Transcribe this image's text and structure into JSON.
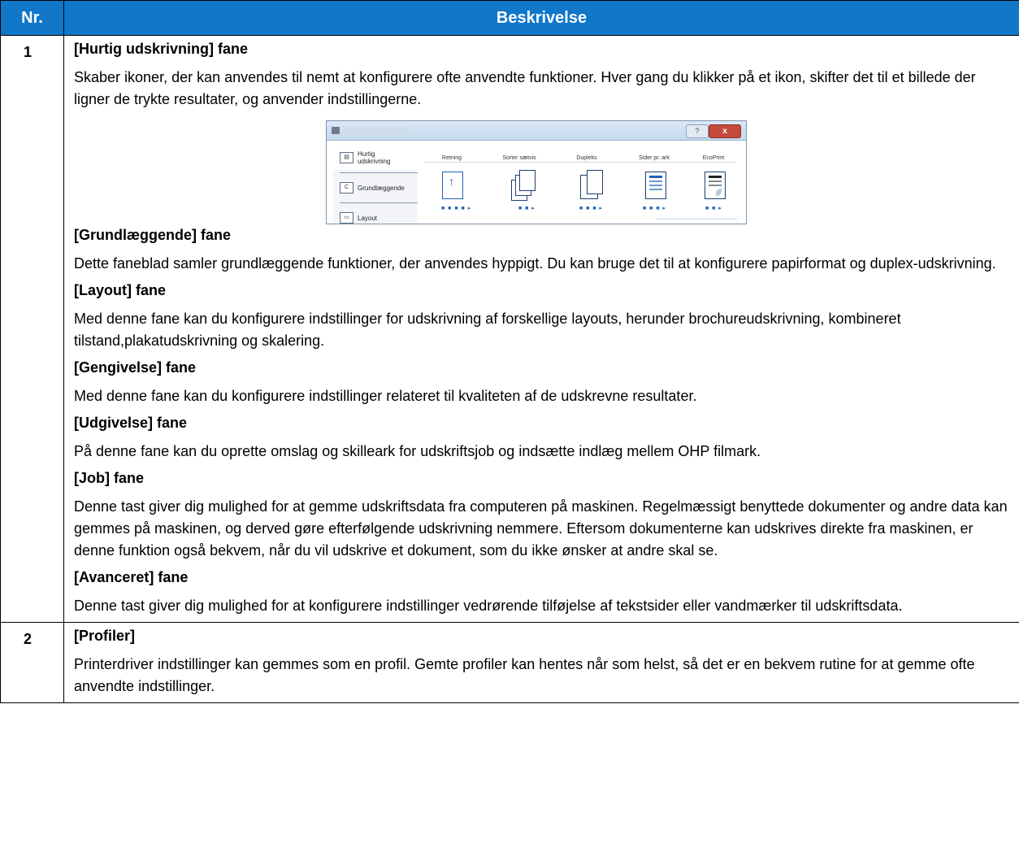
{
  "header": {
    "col_nr": "Nr.",
    "col_desc": "Beskrivelse"
  },
  "colors": {
    "header_bg": "#1177c9",
    "header_text": "#ffffff",
    "dialog_accent": "#1f62b5"
  },
  "rows": [
    {
      "num": "1",
      "sections": [
        {
          "title": "[Hurtig udskrivning] fane",
          "body": "Skaber ikoner, der kan anvendes til nemt at konfigurere ofte anvendte funktioner. Hver gang du klikker på et ikon, skifter det til et billede der ligner de trykte resultater, og anvender indstillingerne."
        },
        {
          "title": "[Grundlæggende] fane",
          "body": "Dette faneblad samler grundlæggende funktioner, der anvendes hyppigt. Du kan bruge det til at konfigurere papirformat og duplex-udskrivning."
        },
        {
          "title": "[Layout] fane",
          "body": "Med denne fane kan du konfigurere indstillinger for udskrivning af forskellige layouts, herunder brochureudskrivning, kombineret tilstand,plakatudskrivning og skalering."
        },
        {
          "title": "[Gengivelse] fane",
          "body": "Med denne fane kan du konfigurere indstillinger relateret til kvaliteten af de udskrevne resultater."
        },
        {
          "title": "[Udgivelse] fane",
          "body": "På denne fane kan du oprette omslag og skilleark for udskriftsjob og indsætte indlæg mellem OHP filmark."
        },
        {
          "title": "[Job] fane",
          "body": "Denne tast giver dig mulighed for at gemme udskriftsdata fra computeren på maskinen. Regelmæssigt benyttede dokumenter og andre data kan gemmes på maskinen, og derved gøre efterfølgende udskrivning nemmere. Eftersom dokumenterne kan udskrives direkte fra maskinen, er denne funktion også bekvem, når du vil udskrive et dokument, som du ikke ønsker at andre skal se."
        },
        {
          "title": "[Avanceret] fane",
          "body": "Denne tast giver dig mulighed for at konfigurere indstillinger vedrørende tilføjelse af tekstsider eller vandmærker til udskriftsdata."
        }
      ]
    },
    {
      "num": "2",
      "sections": [
        {
          "title": "[Profiler]",
          "body": "Printerdriver indstillinger kan gemmes som en profil. Gemte profiler kan hentes når som helst, så det er en bekvem rutine for at gemme ofte anvendte indstillinger."
        }
      ]
    }
  ],
  "screenshot": {
    "help_btn": "?",
    "close_btn": "x",
    "sidebar": [
      {
        "label": "Hurtig udskrivning",
        "icon": "quick-print-icon"
      },
      {
        "label": "Grundlæggende",
        "icon": "basic-icon"
      },
      {
        "label": "Layout",
        "icon": "layout-icon"
      }
    ],
    "columns": [
      "Retning",
      "Sorter sætvis",
      "Dupleks",
      "Sider pr. ark",
      "EcoPrint"
    ],
    "indicators": [
      "■ ■ ■ ■ ▸",
      "■ ■ ▸",
      "■ ■ ■ ▸",
      "■ ■ ■ ▸",
      "■ ■ ▸"
    ]
  }
}
